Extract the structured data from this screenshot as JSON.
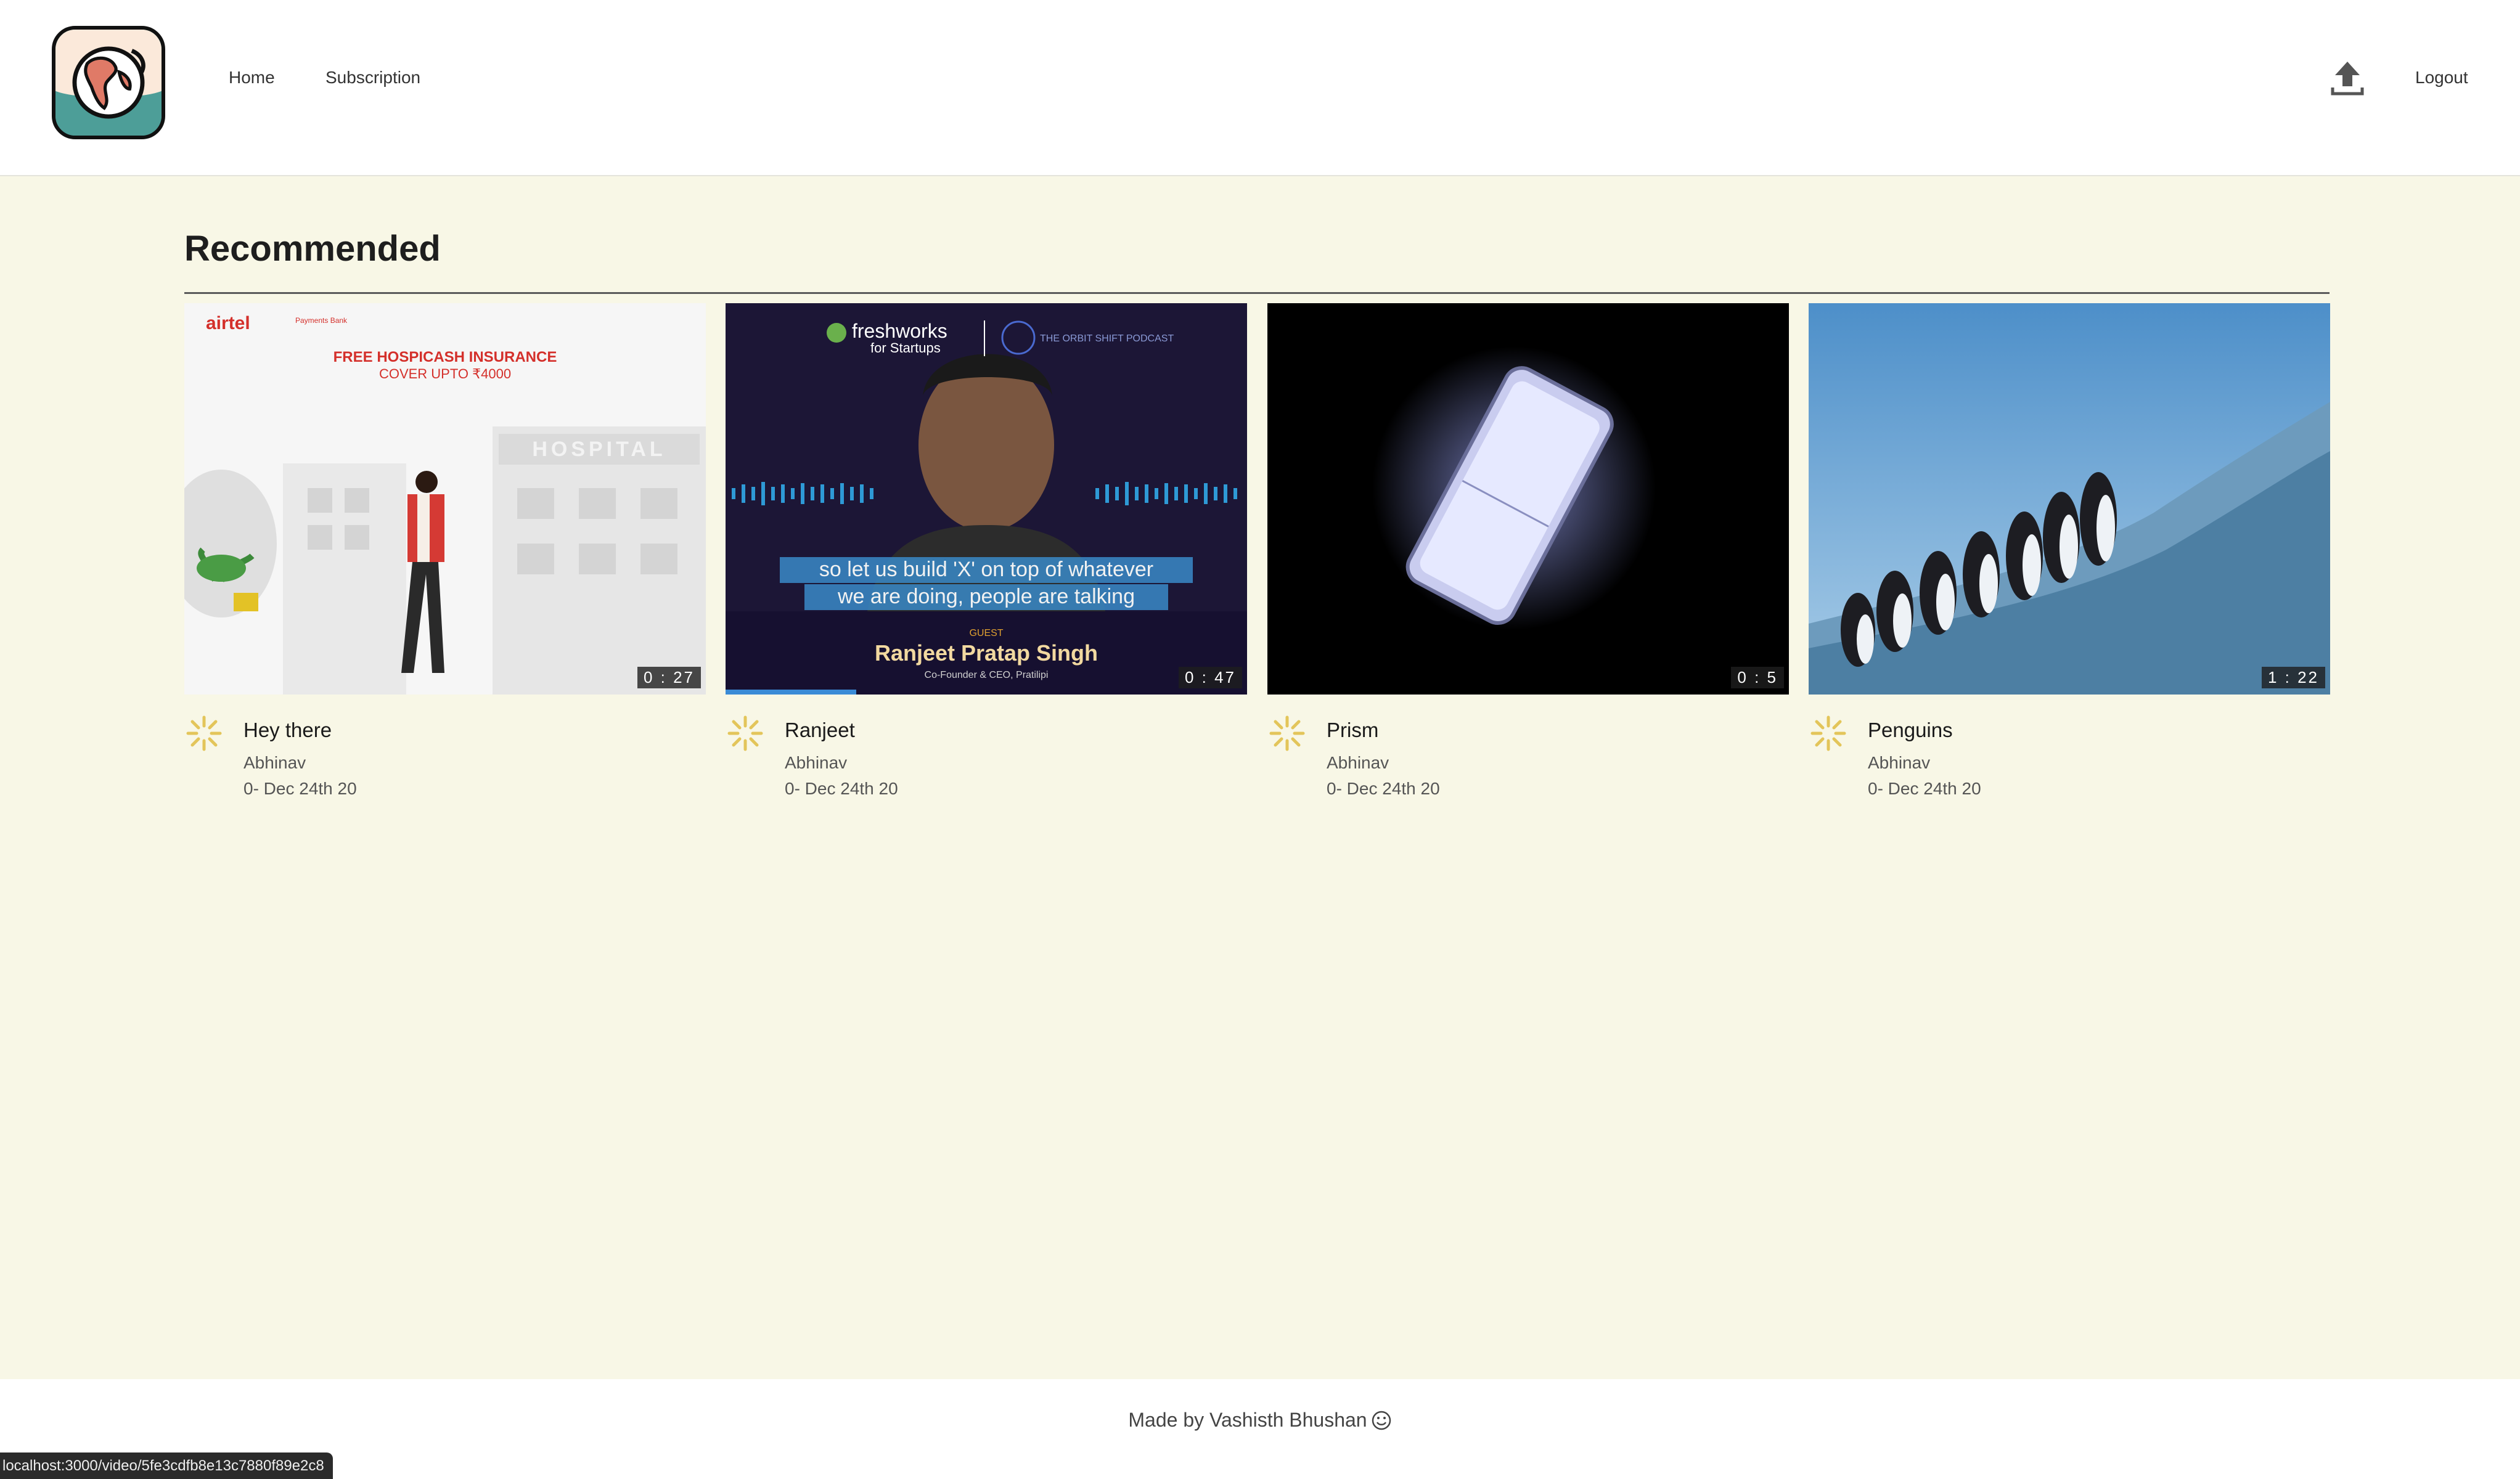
{
  "header": {
    "logo_icon": "globe-logo-icon",
    "nav": {
      "home": "Home",
      "subscription": "Subscription",
      "logout": "Logout"
    },
    "upload_icon": "upload-icon"
  },
  "main": {
    "section_title": "Recommended",
    "videos": [
      {
        "title": "Hey there",
        "author": "Abhinav",
        "date": "0- Dec 24th 20",
        "duration": "0 : 27",
        "thumb": {
          "brand": "airtel",
          "brand_sub": "Payments Bank",
          "headline": "FREE HOSPICASH INSURANCE",
          "subline": "COVER UPTO ₹4000",
          "sign": "HOSPITAL"
        }
      },
      {
        "title": "Ranjeet",
        "author": "Abhinav",
        "date": "0- Dec 24th 20",
        "duration": "0 : 47",
        "progress_fraction": 0.25,
        "thumb": {
          "brand": "freshworks",
          "brand_sub": "for Startups",
          "podcast": "THE ORBIT SHIFT PODCAST",
          "caption_line1": "so let us build 'X' on top of whatever",
          "caption_line2": "we are doing, people are talking",
          "guest_label": "GUEST",
          "guest_name": "Ranjeet Pratap Singh",
          "guest_role": "Co-Founder & CEO, Pratilipi"
        }
      },
      {
        "title": "Prism",
        "author": "Abhinav",
        "date": "0- Dec 24th 20",
        "duration": "0 : 5"
      },
      {
        "title": "Penguins",
        "author": "Abhinav",
        "date": "0- Dec 24th 20",
        "duration": "1 : 22"
      }
    ]
  },
  "footer": {
    "text": "Made by Vashisth Bhushan",
    "icon": "smile-icon"
  },
  "status_bar": {
    "url": "localhost:3000/video/5fe3cdfb8e13c7880f89e2c8"
  },
  "colors": {
    "background": "#f8f7e6",
    "header": "#ffffff",
    "progress": "#3a8bd6",
    "avatar": "#e3c55a"
  }
}
